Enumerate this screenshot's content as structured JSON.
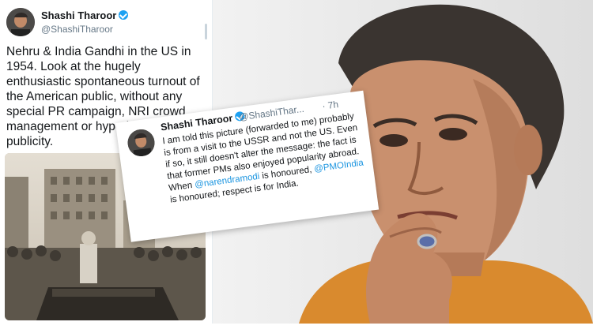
{
  "main_tweet": {
    "author_name": "Shashi Tharoor",
    "handle": "@ShashiTharoor",
    "text": "Nehru & India Gandhi in the US in 1954. Look at the hugely enthusiastic spontaneous turnout of the American public, without any special PR campaign, NRI crowd management or hyped-up media publicity."
  },
  "reply_tweet": {
    "author_name": "Shashi Tharoor",
    "handle": "@ShashiThar...",
    "time": "· 7h",
    "text_part1": "I am told this picture (forwarded to me) probably is from a visit to the USSR and not the US. Even if so, it still doesn't alter the message: the fact is that former PMs also enjoyed popularity abroad. When ",
    "mention1": "@narendramodi",
    "text_part2": " is honoured, ",
    "mention2": "@PMOIndia",
    "text_part3": " is honoured; respect is for India."
  },
  "colors": {
    "verified_blue": "#1da1f2",
    "mention_blue": "#1b95e0",
    "text": "#14171a",
    "secondary_text": "#657786"
  }
}
